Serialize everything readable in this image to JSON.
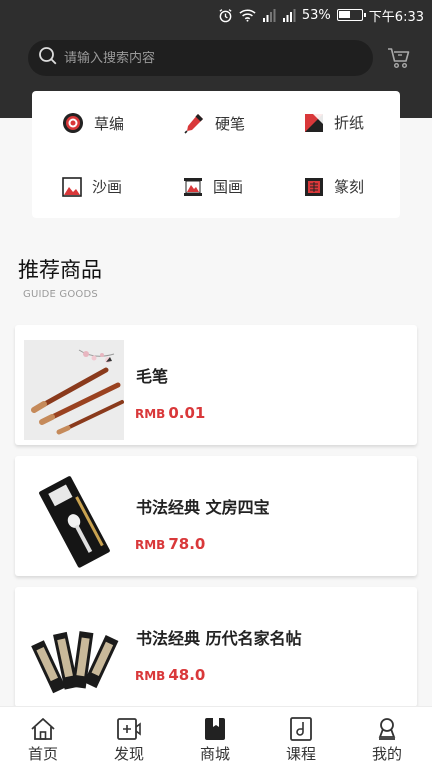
{
  "status_bar": {
    "battery": "53%",
    "battery_level": 0.53,
    "time": "下午6:33"
  },
  "search": {
    "placeholder": "请输入搜索内容"
  },
  "categories": [
    {
      "label": "草编",
      "icon": "straw-weave-icon"
    },
    {
      "label": "硬笔",
      "icon": "pen-icon"
    },
    {
      "label": "折纸",
      "icon": "origami-icon"
    },
    {
      "label": "沙画",
      "icon": "sand-painting-icon"
    },
    {
      "label": "国画",
      "icon": "chinese-painting-icon"
    },
    {
      "label": "篆刻",
      "icon": "seal-carving-icon"
    }
  ],
  "section": {
    "title": "推荐商品",
    "subtitle": "GUIDE GOODS"
  },
  "products": [
    {
      "name": "毛笔",
      "currency": "RMB",
      "price": "0.01"
    },
    {
      "name": "书法经典 文房四宝",
      "currency": "RMB",
      "price": "78.0"
    },
    {
      "name": "书法经典 历代名家名帖",
      "currency": "RMB",
      "price": "48.0"
    }
  ],
  "nav": [
    {
      "label": "首页",
      "icon": "home-icon"
    },
    {
      "label": "发现",
      "icon": "discover-icon"
    },
    {
      "label": "商城",
      "icon": "shop-icon",
      "active": true
    },
    {
      "label": "课程",
      "icon": "course-icon"
    },
    {
      "label": "我的",
      "icon": "profile-icon"
    }
  ],
  "colors": {
    "header": "#2e2e2e",
    "accent": "#d9383a",
    "background": "#f7f7f7"
  }
}
